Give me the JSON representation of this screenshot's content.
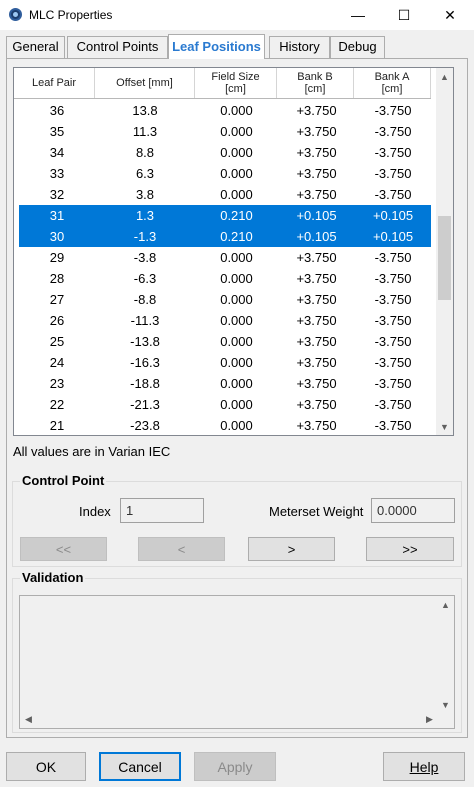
{
  "window": {
    "title": "MLC Properties",
    "minimize_glyph": "—",
    "maximize_glyph": "☐",
    "close_glyph": "✕"
  },
  "tabs": [
    {
      "label": "General"
    },
    {
      "label": "Control Points"
    },
    {
      "label": "Leaf Positions"
    },
    {
      "label": "History"
    },
    {
      "label": "Debug"
    }
  ],
  "grid": {
    "headers": [
      {
        "line1": "Leaf Pair",
        "line2": ""
      },
      {
        "line1": "Offset [mm]",
        "line2": ""
      },
      {
        "line1": "Field Size",
        "line2": "[cm]"
      },
      {
        "line1": "Bank B",
        "line2": "[cm]"
      },
      {
        "line1": "Bank A",
        "line2": "[cm]"
      }
    ],
    "rows": [
      {
        "leaf_pair": "36",
        "offset": "13.8",
        "field_size": "0.000",
        "bank_b": "+3.750",
        "bank_a": "-3.750",
        "selected": false
      },
      {
        "leaf_pair": "35",
        "offset": "11.3",
        "field_size": "0.000",
        "bank_b": "+3.750",
        "bank_a": "-3.750",
        "selected": false
      },
      {
        "leaf_pair": "34",
        "offset": "8.8",
        "field_size": "0.000",
        "bank_b": "+3.750",
        "bank_a": "-3.750",
        "selected": false
      },
      {
        "leaf_pair": "33",
        "offset": "6.3",
        "field_size": "0.000",
        "bank_b": "+3.750",
        "bank_a": "-3.750",
        "selected": false
      },
      {
        "leaf_pair": "32",
        "offset": "3.8",
        "field_size": "0.000",
        "bank_b": "+3.750",
        "bank_a": "-3.750",
        "selected": false
      },
      {
        "leaf_pair": "31",
        "offset": "1.3",
        "field_size": "0.210",
        "bank_b": "+0.105",
        "bank_a": "+0.105",
        "selected": true
      },
      {
        "leaf_pair": "30",
        "offset": "-1.3",
        "field_size": "0.210",
        "bank_b": "+0.105",
        "bank_a": "+0.105",
        "selected": true
      },
      {
        "leaf_pair": "29",
        "offset": "-3.8",
        "field_size": "0.000",
        "bank_b": "+3.750",
        "bank_a": "-3.750",
        "selected": false
      },
      {
        "leaf_pair": "28",
        "offset": "-6.3",
        "field_size": "0.000",
        "bank_b": "+3.750",
        "bank_a": "-3.750",
        "selected": false
      },
      {
        "leaf_pair": "27",
        "offset": "-8.8",
        "field_size": "0.000",
        "bank_b": "+3.750",
        "bank_a": "-3.750",
        "selected": false
      },
      {
        "leaf_pair": "26",
        "offset": "-11.3",
        "field_size": "0.000",
        "bank_b": "+3.750",
        "bank_a": "-3.750",
        "selected": false
      },
      {
        "leaf_pair": "25",
        "offset": "-13.8",
        "field_size": "0.000",
        "bank_b": "+3.750",
        "bank_a": "-3.750",
        "selected": false
      },
      {
        "leaf_pair": "24",
        "offset": "-16.3",
        "field_size": "0.000",
        "bank_b": "+3.750",
        "bank_a": "-3.750",
        "selected": false
      },
      {
        "leaf_pair": "23",
        "offset": "-18.8",
        "field_size": "0.000",
        "bank_b": "+3.750",
        "bank_a": "-3.750",
        "selected": false
      },
      {
        "leaf_pair": "22",
        "offset": "-21.3",
        "field_size": "0.000",
        "bank_b": "+3.750",
        "bank_a": "-3.750",
        "selected": false
      },
      {
        "leaf_pair": "21",
        "offset": "-23.8",
        "field_size": "0.000",
        "bank_b": "+3.750",
        "bank_a": "-3.750",
        "selected": false
      }
    ]
  },
  "note": "All values are in Varian IEC",
  "control_point": {
    "title": "Control Point",
    "index_label": "Index",
    "index_value": "1",
    "meterset_label": "Meterset Weight",
    "meterset_value": "0.0000",
    "first_label": "<<",
    "prev_label": "<",
    "next_label": ">",
    "last_label": ">>"
  },
  "validation": {
    "title": "Validation"
  },
  "buttons": {
    "ok": "OK",
    "cancel": "Cancel",
    "apply": "Apply",
    "help": "Help"
  },
  "colors": {
    "selection": "#0078d7",
    "active_tab_text": "#2a7ad0"
  },
  "icons": {
    "app": "mlc-app-icon",
    "scroll_up": "chevron-up-icon",
    "scroll_down": "chevron-down-icon"
  }
}
